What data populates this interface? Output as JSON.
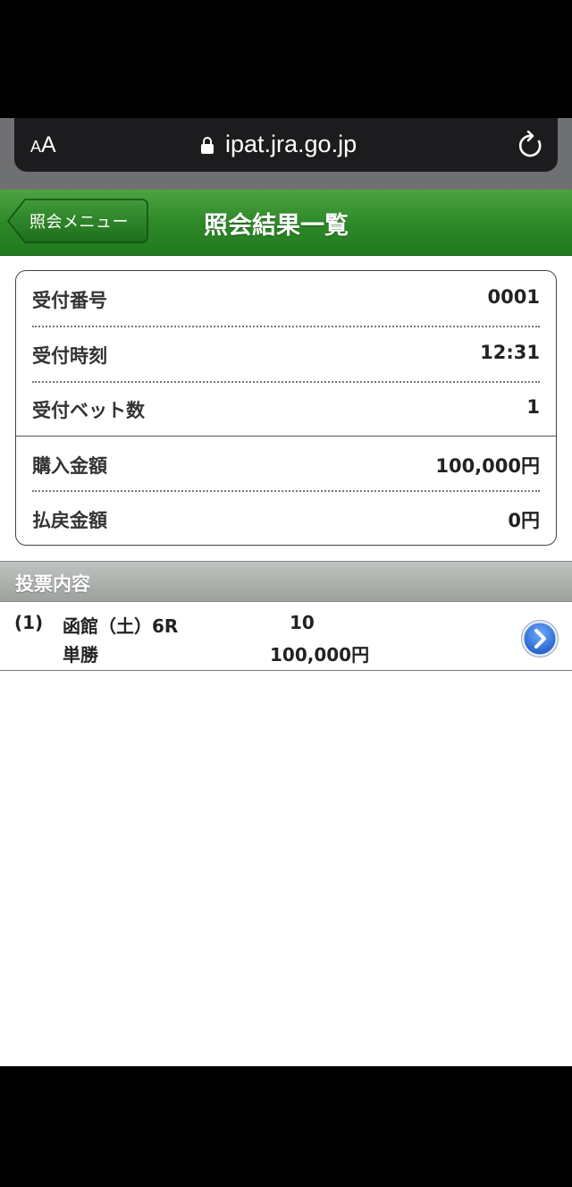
{
  "browser": {
    "aa_small": "A",
    "aa_big": "A",
    "url": "ipat.jra.go.jp"
  },
  "header": {
    "back_label": "照会メニュー",
    "title": "照会結果一覧"
  },
  "info": {
    "rows": [
      {
        "label": "受付番号",
        "value": "0001"
      },
      {
        "label": "受付時刻",
        "value": "12:31"
      },
      {
        "label": "受付ベット数",
        "value": "1"
      },
      {
        "label": "購入金額",
        "value": "100,000円"
      },
      {
        "label": "払戻金額",
        "value": "0円"
      }
    ]
  },
  "section": {
    "title": "投票内容"
  },
  "bet": {
    "index": "(1)",
    "race": "函館（土）6R",
    "horse": "10",
    "type": "単勝",
    "amount": "100,000円"
  },
  "colors": {
    "header_green": "#2e8a28",
    "section_gray": "#9ea29e",
    "detail_blue": "#2a6fd6"
  }
}
